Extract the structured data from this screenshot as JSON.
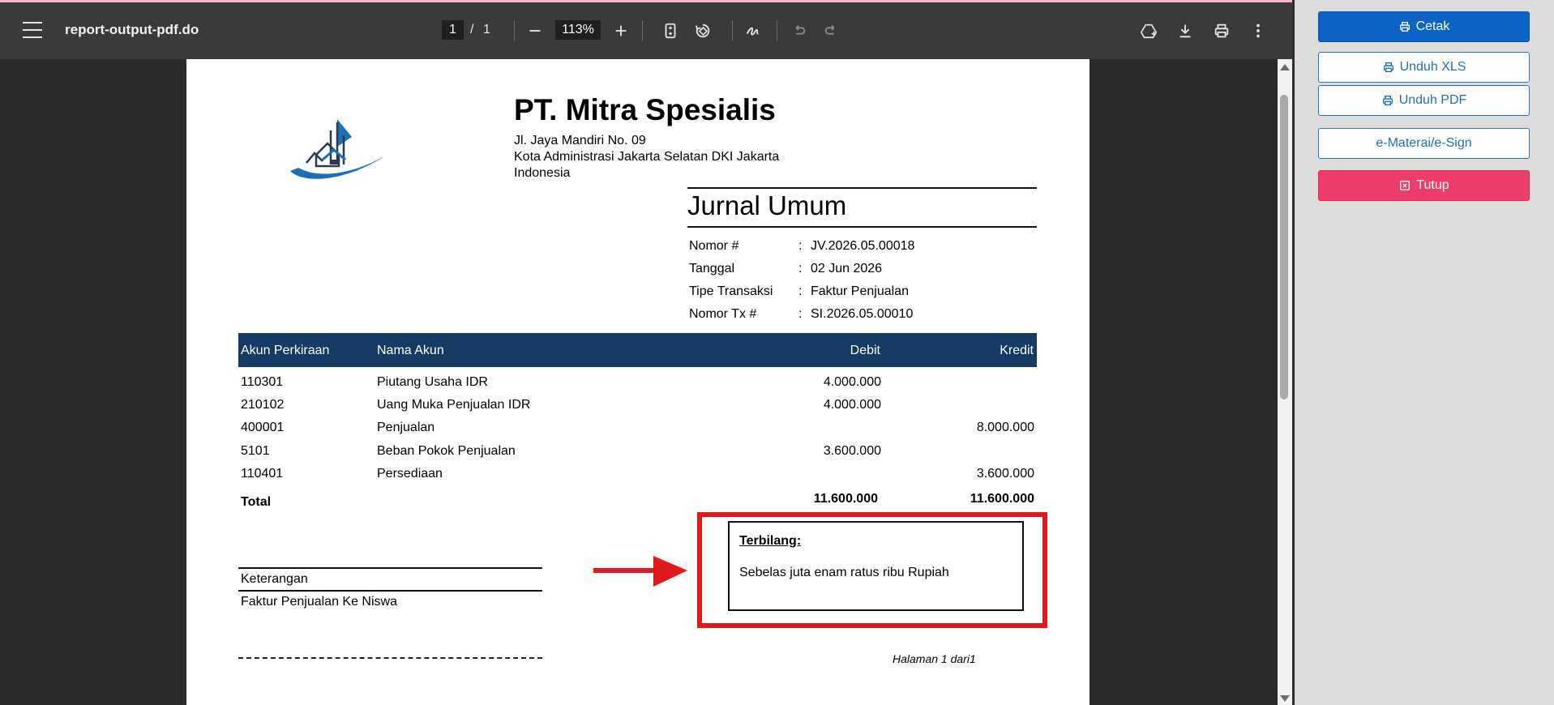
{
  "viewer": {
    "title": "report-output-pdf.do",
    "current_page": "1",
    "page_separator": "/",
    "total_pages": "1",
    "zoom": "113%"
  },
  "company": {
    "name": "PT. Mitra Spesialis",
    "address_line1": "Jl. Jaya Mandiri No. 09",
    "address_line2": "Kota Administrasi Jakarta Selatan DKI Jakarta",
    "address_line3": "Indonesia"
  },
  "document": {
    "title": "Jurnal Umum",
    "meta": [
      {
        "label": "Nomor #",
        "value": "JV.2026.05.00018"
      },
      {
        "label": "Tanggal",
        "value": "02 Jun 2026"
      },
      {
        "label": "Tipe Transaksi",
        "value": "Faktur Penjualan"
      },
      {
        "label": "Nomor Tx #",
        "value": "SI.2026.05.00010"
      }
    ],
    "colon": ":"
  },
  "table": {
    "headers": {
      "account": "Akun Perkiraan",
      "name": "Nama Akun",
      "debit": "Debit",
      "credit": "Kredit"
    },
    "rows": [
      {
        "account": "110301",
        "name": "Piutang Usaha IDR",
        "debit": "4.000.000",
        "credit": ""
      },
      {
        "account": "210102",
        "name": "Uang Muka Penjualan IDR",
        "debit": "4.000.000",
        "credit": ""
      },
      {
        "account": "400001",
        "name": "Penjualan",
        "debit": "",
        "credit": "8.000.000"
      },
      {
        "account": "5101",
        "name": "Beban Pokok Penjualan",
        "debit": "3.600.000",
        "credit": ""
      },
      {
        "account": "110401",
        "name": "Persediaan",
        "debit": "",
        "credit": "3.600.000"
      }
    ],
    "total_label": "Total",
    "total_debit": "11.600.000",
    "total_credit": "11.600.000"
  },
  "notes": {
    "label": "Keterangan",
    "text": "Faktur Penjualan Ke Niswa"
  },
  "terbilang": {
    "title": "Terbilang:",
    "text": "Sebelas juta enam ratus ribu Rupiah"
  },
  "footer": {
    "page_info": "Halaman 1 dari1"
  },
  "panel": {
    "print_label": "Cetak",
    "xls_label": "Unduh XLS",
    "pdf_label": "Unduh PDF",
    "emeterai_label": "e-Materai/e-Sign",
    "close_label": "Tutup"
  },
  "colors": {
    "table_header": "#153a64",
    "highlight_red": "#e0191f",
    "primary_button": "#0b63c5",
    "danger_button": "#ef3d6b"
  }
}
